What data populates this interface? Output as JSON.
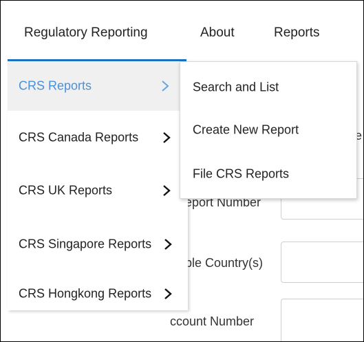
{
  "topnav": {
    "tabs": [
      {
        "label": "Regulatory Reporting"
      },
      {
        "label": "About"
      },
      {
        "label": "Reports"
      }
    ]
  },
  "menu": {
    "items": [
      {
        "label": "CRS Reports"
      },
      {
        "label": "CRS Canada Reports"
      },
      {
        "label": "CRS UK Reports"
      },
      {
        "label": "CRS Singapore Reports"
      },
      {
        "label": "CRS Hongkong Reports"
      }
    ]
  },
  "submenu": {
    "items": [
      {
        "label": "Search and List"
      },
      {
        "label": "Create New Report"
      },
      {
        "label": "File CRS Reports"
      }
    ]
  },
  "form": {
    "labels": {
      "partial_e": "e",
      "report_number": "eport Number",
      "country": "ble Country(s)",
      "account_number": "ccount Number"
    }
  },
  "colors": {
    "accent": "#1a73c7",
    "active_text": "#4a90d9",
    "active_bg": "#f0f0f0"
  }
}
